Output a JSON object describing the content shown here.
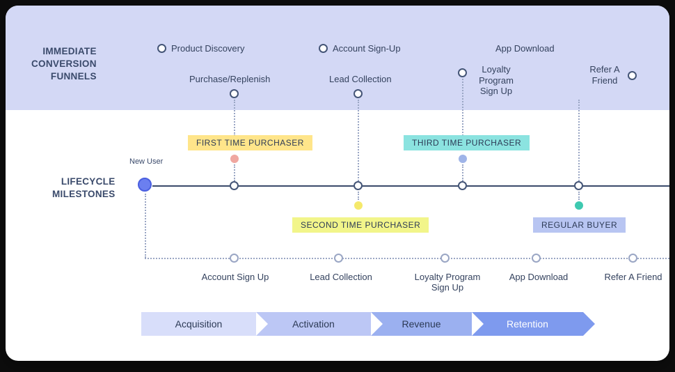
{
  "section_labels": {
    "immediate": "IMMEDIATE\nCONVERSION\nFUNNELS",
    "lifecycle": "LIFECYCLE\nMILESTONES"
  },
  "funnels": {
    "product_discovery": "Product Discovery",
    "account_signup": "Account Sign-Up",
    "app_download": "App Download",
    "purchase_replenish": "Purchase/Replenish",
    "lead_collection": "Lead Collection",
    "loyalty": "Loyalty Program Sign Up",
    "refer_friend": "Refer A Friend"
  },
  "new_user_label": "New User",
  "milestones": {
    "first": "FIRST TIME PURCHASER",
    "second": "SECOND TIME PURCHASER",
    "third": "THIRD TIME PURCHASER",
    "regular": "REGULAR BUYER"
  },
  "actions": {
    "account_signup": "Account Sign Up",
    "lead_collection": "Lead Collection",
    "loyalty": "Loyalty Program Sign Up",
    "app_download": "App Download",
    "refer_friend": "Refer A Friend"
  },
  "phases": {
    "acquisition": "Acquisition",
    "activation": "Activation",
    "revenue": "Revenue",
    "retention": "Retention"
  },
  "colors": {
    "badge_first": "#ffe58a",
    "badge_second": "#f2f58a",
    "badge_third": "#8be3e0",
    "badge_regular": "#b8c5f2",
    "dot_first": "#f0a7a0",
    "dot_second": "#f5e96b",
    "dot_third": "#9fb4e8",
    "dot_regular": "#3ec9b0",
    "phase_1": "#d8defa",
    "phase_2": "#bcc7f5",
    "phase_3": "#9bb0f0",
    "phase_4": "#7e9aee"
  }
}
